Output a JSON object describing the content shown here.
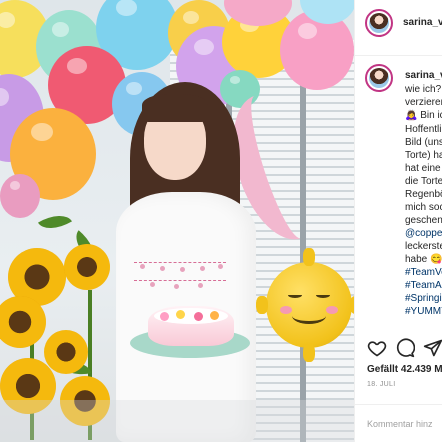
{
  "post": {
    "header": {
      "username": "sarina_vs"
    },
    "caption": {
      "username": "sarina_vs",
      "lines": [
        "wie ich?",
        "verzieren",
        "🙇‍♀️ Bin ic",
        "Hoffentli",
        "Bild (uns",
        "Torte) ha",
        "hat eine",
        "die Torte",
        "Regenbö",
        "mich soc",
        "geschenk"
      ],
      "mention": "@coppe",
      "more_lines": [
        "leckerste",
        "habe 😋"
      ],
      "hashtags": [
        "#TeamVe",
        "#TeamAu",
        "#Springi",
        "#YUMMY"
      ]
    },
    "actions": {
      "like_icon": "heart-icon",
      "comment_icon": "comment-icon",
      "share_icon": "share-icon"
    },
    "likes_text": "Gefällt 42.439 M",
    "date_text": "18. JULI",
    "add_comment": {
      "placeholder": "Kommentar hinz"
    },
    "colors": {
      "text": "#262626",
      "hashtag": "#003569",
      "muted": "#8e8e8e",
      "avatar_ring": "#c13584"
    }
  }
}
